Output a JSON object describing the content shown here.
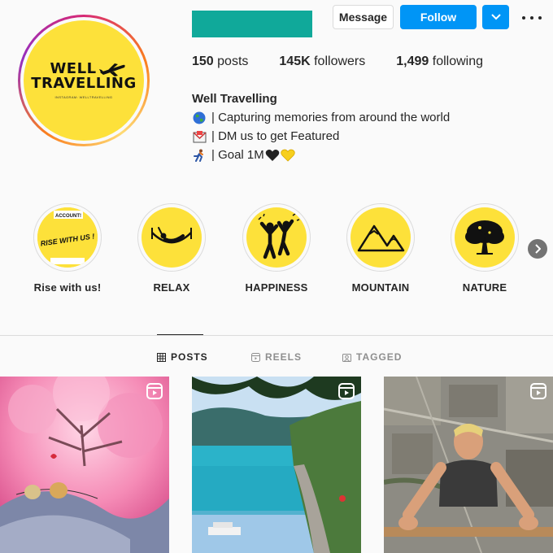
{
  "profile": {
    "avatar_logo_line1": "WELL",
    "avatar_logo_line2": "TRAVELLING",
    "avatar_logo_sub": "INSTAGRAM: WELLTRAVELLING"
  },
  "actions": {
    "message_label": "Message",
    "follow_label": "Follow"
  },
  "stats": {
    "posts_value": "150",
    "posts_label": "posts",
    "followers_value": "145K",
    "followers_label": "followers",
    "following_value": "1,499",
    "following_label": "following"
  },
  "bio": {
    "name": "Well Travelling",
    "lines": [
      {
        "icon": "globe-icon",
        "text": "| Capturing memories from around the world"
      },
      {
        "icon": "envelope-icon",
        "text": "| DM us to get Featured"
      },
      {
        "icon": "runner-icon",
        "text": "| Goal 1M"
      }
    ],
    "hearts": [
      "black-heart-icon",
      "yellow-heart-icon"
    ]
  },
  "highlights": [
    {
      "label": "Rise with us!",
      "cover_text": "RISE WITH US !",
      "cover_top": "ACCOUNT!"
    },
    {
      "label": "RELAX",
      "icon": "hammock-icon"
    },
    {
      "label": "HAPPINESS",
      "icon": "celebrating-people-icon"
    },
    {
      "label": "MOUNTAIN",
      "icon": "mountain-icon"
    },
    {
      "label": "NATURE",
      "icon": "tree-icon"
    }
  ],
  "tabs": [
    {
      "label": "POSTS",
      "icon": "grid-icon",
      "active": true
    },
    {
      "label": "REELS",
      "icon": "reels-icon",
      "active": false
    },
    {
      "label": "TAGGED",
      "icon": "tagged-icon",
      "active": false
    }
  ],
  "posts": [
    {
      "kind": "reel",
      "subject": "pink cherry blossom tree with two snails"
    },
    {
      "kind": "reel",
      "subject": "turquoise lake with cliffside road"
    },
    {
      "kind": "reel",
      "subject": "man hanging above aerial city view"
    }
  ],
  "colors": {
    "accent_blue": "#0095f6",
    "brand_yellow": "#fde13a",
    "username_redaction": "#10a99a"
  }
}
